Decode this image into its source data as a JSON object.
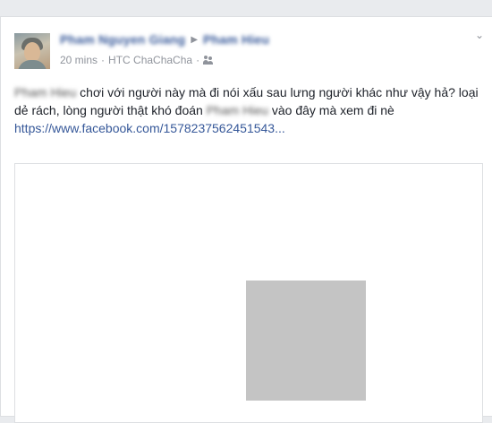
{
  "post": {
    "author_name": "Pham Nguyen Giang",
    "target_name": "Pham Hieu",
    "time": "20 mins",
    "separator": "·",
    "device": "HTC ChaChaCha",
    "text_mention_start": "Pham Hieu",
    "text_part1": " chơi với người này mà đi nói xấu sau lưng người khác như vậy hả? loại dẻ rách, lòng người thật khó đoán ",
    "text_mention_mid": "Pham Hieu",
    "text_part2": " vào đây mà xem đi nè",
    "link_text": "https://www.facebook.com/1578237562451543..."
  },
  "icons": {
    "privacy": "friends-icon",
    "options": "chevron-down-icon",
    "arrow": "triangle-right-icon"
  },
  "colors": {
    "link": "#365899",
    "meta": "#90949c",
    "text": "#1d2129",
    "placeholder": "#c4c4c4"
  }
}
